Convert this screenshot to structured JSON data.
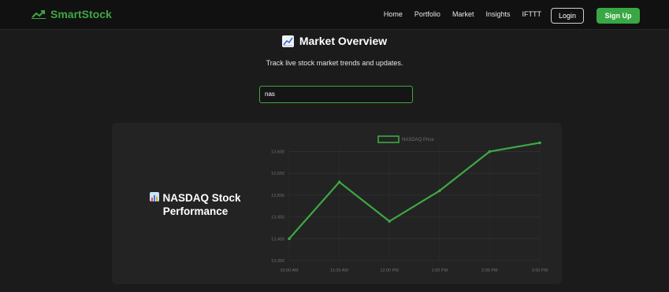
{
  "brand": {
    "name": "SmartStock",
    "color": "#3ea845",
    "icon": "trending-up-icon"
  },
  "nav": {
    "links": [
      "Home",
      "Portfolio",
      "Market",
      "Insights",
      "IFTTT"
    ],
    "login_label": "Login",
    "signup_label": "Sign Up"
  },
  "hero": {
    "title": "Market Overview",
    "title_icon": "chart-emoji-icon",
    "subtitle": "Track live stock market trends and updates."
  },
  "search": {
    "value": "nas"
  },
  "card": {
    "title": "NASDAQ Stock Performance",
    "title_icon": "bar-chart-emoji-icon"
  },
  "chart_data": {
    "type": "line",
    "categories": [
      "10:00 AM",
      "11:00 AM",
      "12:00 PM",
      "1:00 PM",
      "2:00 PM",
      "3:00 PM"
    ],
    "series": [
      {
        "name": "NASDAQ Price",
        "values": [
          13400,
          13530,
          13440,
          13510,
          13600,
          13620
        ],
        "color": "#3ea845"
      }
    ],
    "yticks": [
      13350,
      13400,
      13450,
      13500,
      13550,
      13600
    ],
    "ytick_labels": [
      "13,350",
      "13,400",
      "13,450",
      "13,500",
      "13,550",
      "13,600"
    ],
    "ylim": [
      13350,
      13610
    ],
    "legend_position": "top-center",
    "grid": true
  }
}
